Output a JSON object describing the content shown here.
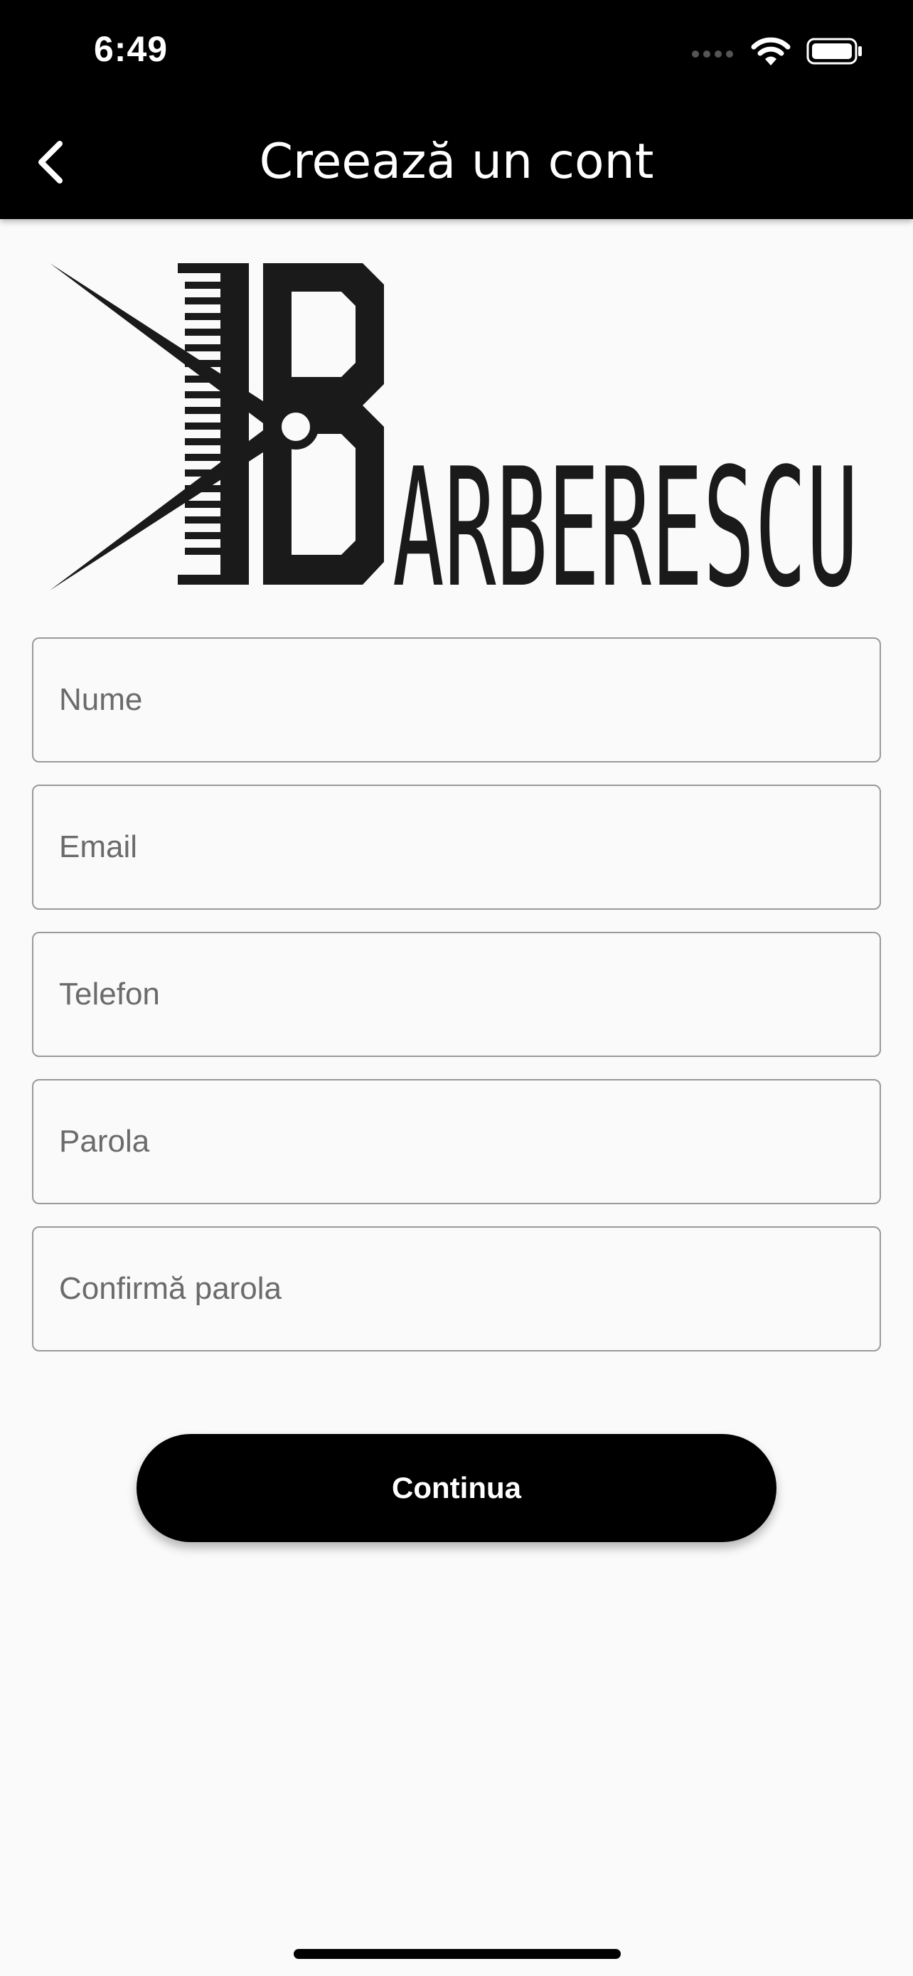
{
  "status_bar": {
    "time": "6:49",
    "icons": [
      "signal-icon",
      "wifi-icon",
      "battery-icon"
    ]
  },
  "nav": {
    "back_icon": "chevron-left-icon",
    "title": "Creează un cont"
  },
  "logo": {
    "text": "BARBERESCU"
  },
  "form": {
    "name_placeholder": "Nume",
    "email_placeholder": "Email",
    "phone_placeholder": "Telefon",
    "password_placeholder": "Parola",
    "confirm_password_placeholder": "Confirmă parola"
  },
  "actions": {
    "continue_label": "Continua"
  },
  "colors": {
    "bar_background": "#000000",
    "page_background": "#fafafa",
    "field_border": "#9a9a9a",
    "button_background": "#000000",
    "button_text": "#ffffff",
    "logo_color": "#1a1a1a"
  }
}
